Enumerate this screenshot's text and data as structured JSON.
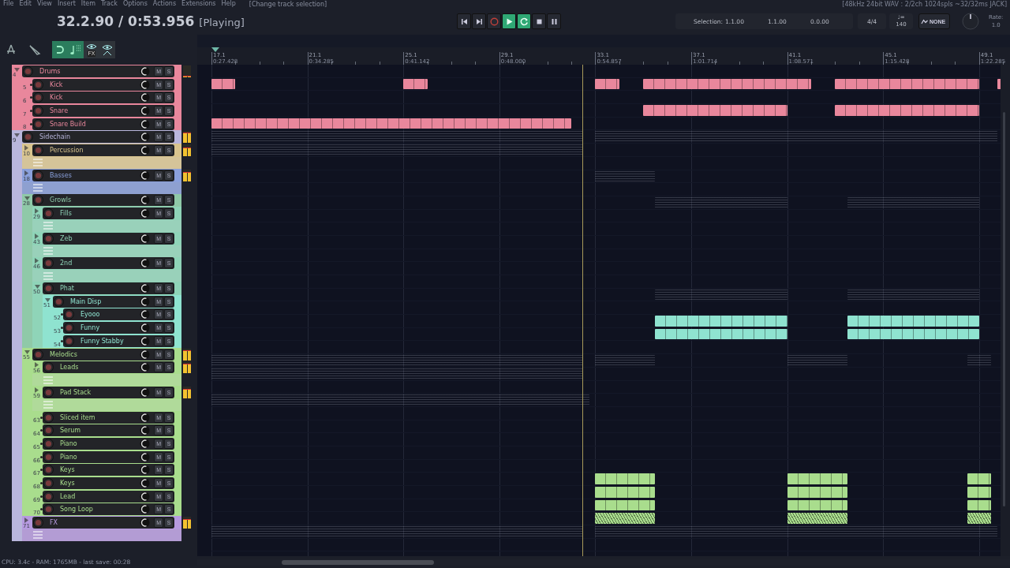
{
  "menu": [
    "File",
    "Edit",
    "View",
    "Insert",
    "Item",
    "Track",
    "Options",
    "Actions",
    "Extensions",
    "Help"
  ],
  "last_action": "[Change track selection]",
  "engine_info": "[48kHz 24bit WAV : 2/2ch 1024spls ~32/32ms JACK]",
  "clock": "32.2.90 / 0:53.956",
  "play_state": "[Playing]",
  "transport": [
    {
      "kind": "prev",
      "on": false
    },
    {
      "kind": "next",
      "on": false
    },
    {
      "kind": "record",
      "on": false
    },
    {
      "kind": "play",
      "on": true
    },
    {
      "kind": "loop",
      "on": true
    },
    {
      "kind": "stop",
      "on": false
    },
    {
      "kind": "pause",
      "on": false
    }
  ],
  "selection": {
    "label": "Selection:",
    "values": [
      "1.1.00",
      "1.1.00",
      "0.0.00"
    ]
  },
  "time_signature": "4/4",
  "tempo": {
    "label": "♩=",
    "value": "140"
  },
  "snap_mode": "NONE",
  "rate": {
    "label": "Rate:",
    "value": "1.0"
  },
  "tools": [
    {
      "kind": "select"
    },
    {
      "kind": "edit"
    }
  ],
  "toggles": [
    {
      "kind": "snap",
      "on": true
    },
    {
      "kind": "note-snap",
      "on": true
    },
    {
      "kind": "fx-view",
      "label": "FX",
      "on": false
    },
    {
      "kind": "automation-view",
      "on": false
    }
  ],
  "ruler": [
    {
      "bar": "17.1",
      "time": "0:27.428"
    },
    {
      "bar": "21.1",
      "time": "0:34.285"
    },
    {
      "bar": "25.1",
      "time": "0:41.142"
    },
    {
      "bar": "29.1",
      "time": "0:48.000"
    },
    {
      "bar": "33.1",
      "time": "0:54.857"
    },
    {
      "bar": "37.1",
      "time": "1:01.714"
    },
    {
      "bar": "41.1",
      "time": "1:08.571"
    },
    {
      "bar": "45.1",
      "time": "1:15.428"
    },
    {
      "bar": "49.1",
      "time": "1:22.285"
    }
  ],
  "tracks": [
    {
      "number": "4",
      "name": "Drums",
      "color": "#e9879c",
      "expanded": true,
      "level": 0.15,
      "buttons": [
        "M",
        "S"
      ],
      "children": [
        {
          "number": "5",
          "name": "Kick",
          "color": "#e9879c",
          "buttons": [
            "M",
            "S"
          ],
          "regions": [
            {
              "kind": "midi"
            },
            {
              "kind": "midi"
            },
            {
              "kind": "midi"
            },
            {
              "kind": "midi"
            },
            {
              "kind": "midi"
            },
            {
              "kind": "midi"
            }
          ]
        },
        {
          "number": "6",
          "name": "Kick",
          "color": "#e9879c",
          "buttons": [
            "M",
            "S"
          ]
        },
        {
          "number": "7",
          "name": "Snare",
          "color": "#e9879c",
          "buttons": [
            "M",
            "S"
          ],
          "regions": [
            {
              "kind": "midi"
            },
            {
              "kind": "midi"
            }
          ]
        },
        {
          "number": "8",
          "name": "Snare Build",
          "color": "#e9879c",
          "buttons": [
            "M",
            "S"
          ],
          "regions": [
            {
              "kind": "midi"
            }
          ]
        }
      ]
    },
    {
      "number": "9",
      "name": "Sidechain",
      "color": "#b9b6dc",
      "expanded": true,
      "level": 0.9,
      "buttons": [
        "M",
        "S"
      ],
      "regions": [
        {
          "kind": "summary"
        },
        {
          "kind": "summary"
        }
      ],
      "children": [
        {
          "number": "10",
          "name": "Percussion",
          "color": "#d9c48e",
          "expanded": false,
          "lanes_shown": true,
          "level": 0.75,
          "buttons": [
            "M",
            "S"
          ],
          "regions": [
            {
              "kind": "summary"
            }
          ]
        },
        {
          "number": "18",
          "name": "Basses",
          "color": "#8aa0dc",
          "expanded": false,
          "lanes_shown": true,
          "level": 0.8,
          "buttons": [
            "M",
            "S"
          ],
          "regions": [
            {
              "kind": "summary"
            }
          ]
        },
        {
          "number": "28",
          "name": "Growls",
          "color": "#8fc9a8",
          "expanded": true,
          "buttons": [
            "M",
            "S"
          ],
          "regions": [
            {
              "kind": "summary"
            },
            {
              "kind": "summary"
            }
          ],
          "children": [
            {
              "number": "29",
              "name": "Fills",
              "color": "#8fd4b8",
              "expanded": false,
              "lanes_shown": true,
              "buttons": [
                "M",
                "S"
              ]
            },
            {
              "number": "43",
              "name": "Zeb",
              "color": "#8fd4b8",
              "expanded": false,
              "lanes_shown": true,
              "buttons": [
                "M",
                "S"
              ]
            },
            {
              "number": "46",
              "name": "2nd",
              "color": "#8fd4b8",
              "expanded": false,
              "lanes_shown": true,
              "buttons": [
                "M",
                "S"
              ]
            },
            {
              "number": "50",
              "name": "Phat",
              "color": "#8fd4b8",
              "expanded": true,
              "buttons": [
                "M",
                "S"
              ],
              "regions": [
                {
                  "kind": "summary"
                },
                {
                  "kind": "summary"
                }
              ],
              "children": [
                {
                  "number": "51",
                  "name": "Main Disp",
                  "color": "#8fe3d0",
                  "expanded": true,
                  "buttons": [
                    "M",
                    "S"
                  ],
                  "children": [
                    {
                      "number": "52",
                      "name": "Eyooo",
                      "color": "#8fe3d0",
                      "buttons": [
                        "M",
                        "S"
                      ],
                      "regions": [
                        {
                          "kind": "midi"
                        },
                        {
                          "kind": "midi"
                        }
                      ]
                    },
                    {
                      "number": "53",
                      "name": "Funny",
                      "color": "#8fe3d0",
                      "buttons": [
                        "M",
                        "S"
                      ],
                      "regions": [
                        {
                          "kind": "midi"
                        },
                        {
                          "kind": "midi"
                        }
                      ]
                    },
                    {
                      "number": "54",
                      "name": "Funny Stabby",
                      "color": "#8fe3d0",
                      "buttons": [
                        "M",
                        "S"
                      ]
                    }
                  ]
                }
              ]
            }
          ]
        },
        {
          "number": "55",
          "name": "Melodics",
          "color": "#a9dd8d",
          "expanded": true,
          "level": 0.85,
          "buttons": [
            "M",
            "S"
          ],
          "regions": [
            {
              "kind": "summary"
            },
            {
              "kind": "summary"
            },
            {
              "kind": "summary"
            },
            {
              "kind": "summary"
            }
          ],
          "children": [
            {
              "number": "56",
              "name": "Leads",
              "color": "#a9dd8d",
              "expanded": false,
              "lanes_shown": true,
              "level": 0.85,
              "buttons": [
                "M",
                "S"
              ],
              "regions": [
                {
                  "kind": "summary"
                }
              ]
            },
            {
              "number": "59",
              "name": "Pad Stack",
              "color": "#a9dd8d",
              "expanded": false,
              "lanes_shown": true,
              "level": 0.8,
              "buttons": [
                "M",
                "S"
              ],
              "regions": [
                {
                  "kind": "summary"
                }
              ]
            },
            {
              "number": "63",
              "name": "Sliced item",
              "color": "#a9dd8d",
              "buttons": [
                "M",
                "S"
              ]
            },
            {
              "number": "64",
              "name": "Serum",
              "color": "#a9dd8d",
              "buttons": [
                "M",
                "S"
              ]
            },
            {
              "number": "65",
              "name": "Piano",
              "color": "#a9dd8d",
              "buttons": [
                "M",
                "S"
              ]
            },
            {
              "number": "66",
              "name": "Piano",
              "color": "#a9dd8d",
              "buttons": [
                "M",
                "S"
              ]
            },
            {
              "number": "67",
              "name": "Keys",
              "color": "#a9dd8d",
              "buttons": [
                "M",
                "S"
              ],
              "regions": [
                {
                  "kind": "midi"
                },
                {
                  "kind": "midi"
                },
                {
                  "kind": "midi"
                }
              ]
            },
            {
              "number": "68",
              "name": "Keys",
              "color": "#a9dd8d",
              "buttons": [
                "M",
                "S"
              ],
              "regions": [
                {
                  "kind": "midi"
                },
                {
                  "kind": "midi"
                },
                {
                  "kind": "midi"
                }
              ]
            },
            {
              "number": "69",
              "name": "Lead",
              "color": "#a9dd8d",
              "buttons": [
                "M",
                "S"
              ],
              "regions": [
                {
                  "kind": "midi"
                },
                {
                  "kind": "midi"
                },
                {
                  "kind": "midi"
                }
              ]
            },
            {
              "number": "70",
              "name": "Song Loop",
              "color": "#a9dd8d",
              "buttons": [
                "M",
                "S"
              ],
              "regions": [
                {
                  "kind": "audio"
                },
                {
                  "kind": "audio"
                },
                {
                  "kind": "audio"
                }
              ]
            }
          ]
        },
        {
          "number": "71",
          "name": "FX",
          "color": "#b69ae0",
          "expanded": false,
          "lanes_shown": true,
          "level": 0.85,
          "buttons": [
            "M",
            "S"
          ],
          "regions": [
            {
              "kind": "summary"
            },
            {
              "kind": "summary"
            }
          ]
        }
      ]
    }
  ],
  "status_bar": "CPU: 3.4c - RAM: 1765MB -  last save: 00:28"
}
